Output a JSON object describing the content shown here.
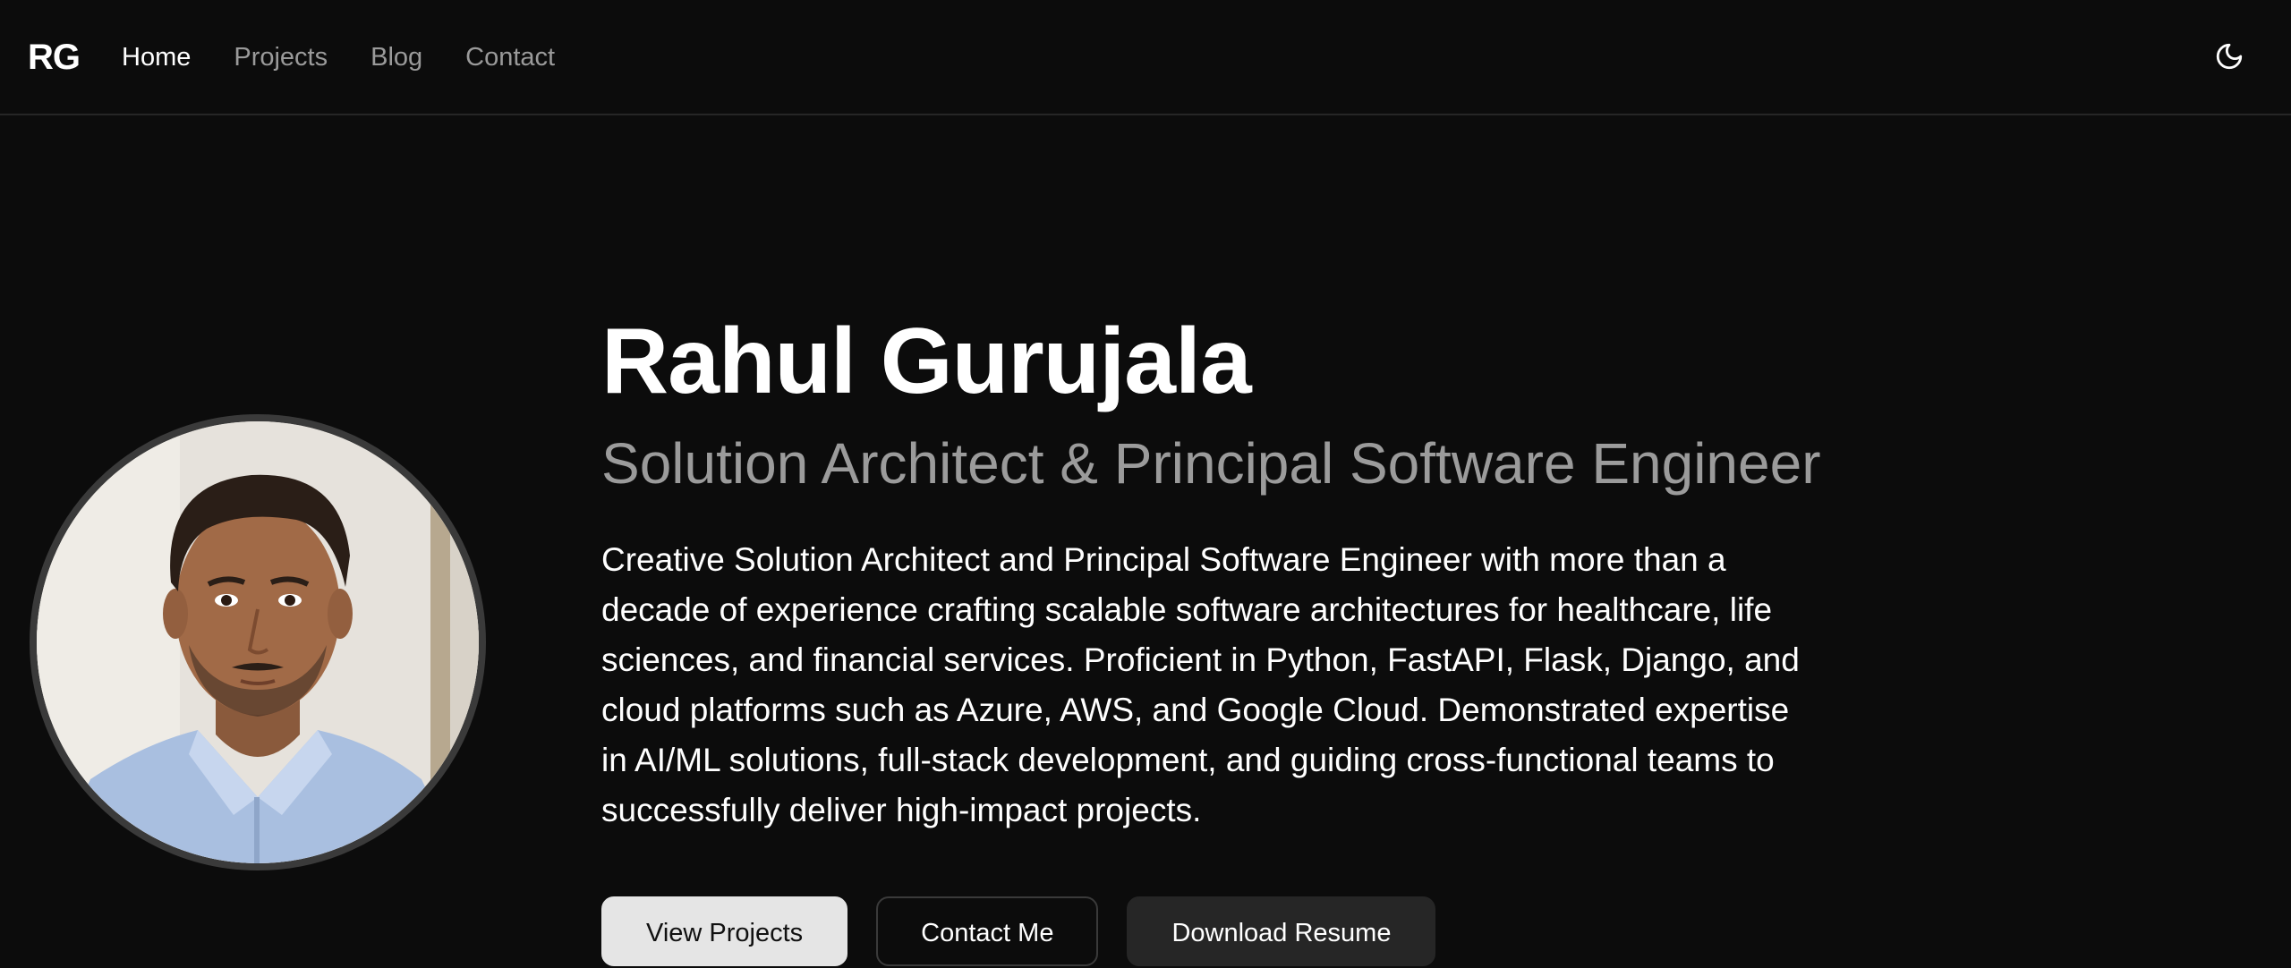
{
  "nav": {
    "logo": "RG",
    "links": [
      {
        "label": "Home",
        "active": true
      },
      {
        "label": "Projects",
        "active": false
      },
      {
        "label": "Blog",
        "active": false
      },
      {
        "label": "Contact",
        "active": false
      }
    ],
    "theme_toggle_icon": "moon-icon"
  },
  "hero": {
    "name": "Rahul Gurujala",
    "role": "Solution Architect & Principal Software Engineer",
    "bio": "Creative Solution Architect and Principal Software Engineer with more than a decade of experience crafting scalable software architectures for healthcare, life sciences, and financial services. Proficient in Python, FastAPI, Flask, Django, and cloud platforms such as Azure, AWS, and Google Cloud. Demonstrated expertise in AI/ML solutions, full-stack development, and guiding cross-functional teams to successfully deliver high-impact projects.",
    "buttons": {
      "view_projects": "View Projects",
      "contact_me": "Contact Me",
      "download_resume": "Download Resume"
    }
  },
  "colors": {
    "background": "#0c0c0c",
    "text_primary": "#ffffff",
    "text_muted": "#9b9b9b",
    "border": "#262626",
    "button_primary_bg": "#e5e5e5"
  }
}
